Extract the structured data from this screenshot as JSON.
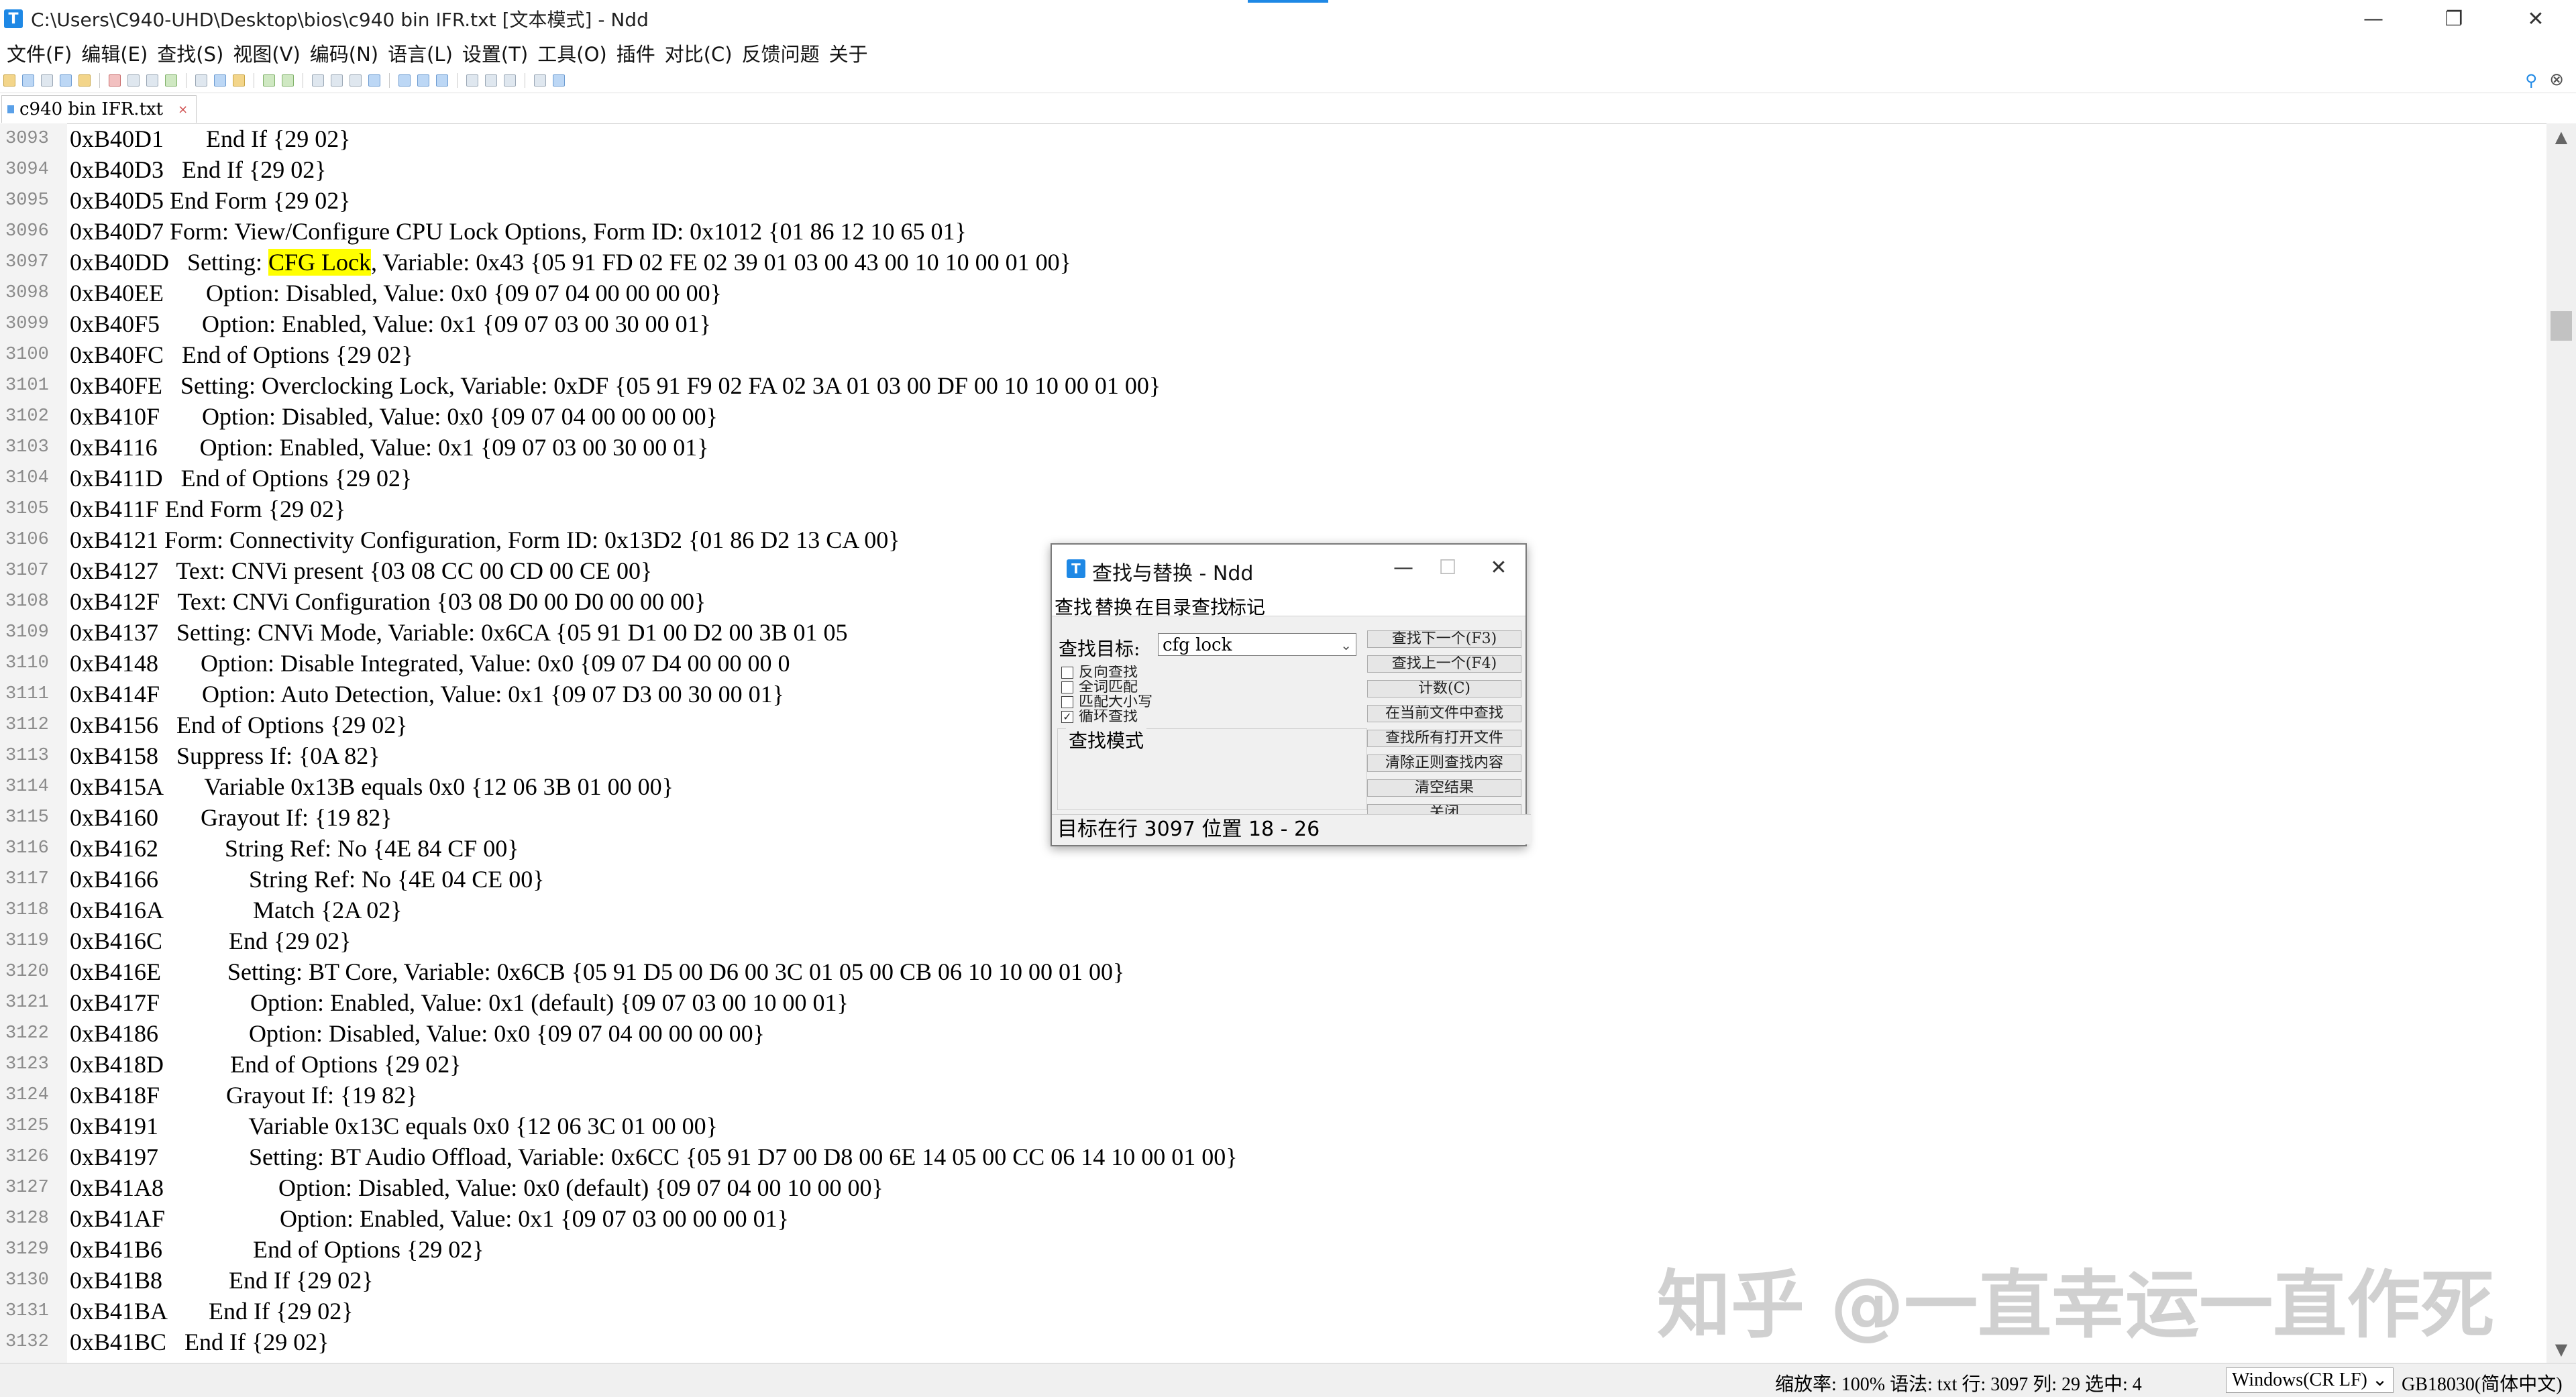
{
  "window": {
    "title": "C:\\Users\\C940-UHD\\Desktop\\bios\\c940 bin IFR.txt [文本模式] - Ndd",
    "app_icon_letter": "T",
    "minimize": "—",
    "restore": "❐",
    "close": "✕"
  },
  "menu": [
    "文件(F)",
    "编辑(E)",
    "查找(S)",
    "视图(V)",
    "编码(N)",
    "语言(L)",
    "设置(T)",
    "工具(O)",
    "插件",
    "对比(C)",
    "反馈问题",
    "关于"
  ],
  "tab": {
    "label": "c940 bin IFR.txt",
    "close": "×"
  },
  "editor": {
    "highlight": "CFG Lock",
    "lines": [
      {
        "n": "3093",
        "t": "0xB40D1       End If {29 02}"
      },
      {
        "n": "3094",
        "t": "0xB40D3   End If {29 02}"
      },
      {
        "n": "3095",
        "t": "0xB40D5 End Form {29 02}"
      },
      {
        "n": "3096",
        "t": "0xB40D7 Form: View/Configure CPU Lock Options, Form ID: 0x1012 {01 86 12 10 65 01}"
      },
      {
        "n": "3097",
        "t": "0xB40DD   Setting: CFG Lock, Variable: 0x43 {05 91 FD 02 FE 02 39 01 03 00 43 00 10 10 00 01 00}"
      },
      {
        "n": "3098",
        "t": "0xB40EE       Option: Disabled, Value: 0x0 {09 07 04 00 00 00 00}"
      },
      {
        "n": "3099",
        "t": "0xB40F5       Option: Enabled, Value: 0x1 {09 07 03 00 30 00 01}"
      },
      {
        "n": "3100",
        "t": "0xB40FC   End of Options {29 02}"
      },
      {
        "n": "3101",
        "t": "0xB40FE   Setting: Overclocking Lock, Variable: 0xDF {05 91 F9 02 FA 02 3A 01 03 00 DF 00 10 10 00 01 00}"
      },
      {
        "n": "3102",
        "t": "0xB410F       Option: Disabled, Value: 0x0 {09 07 04 00 00 00 00}"
      },
      {
        "n": "3103",
        "t": "0xB4116       Option: Enabled, Value: 0x1 {09 07 03 00 30 00 01}"
      },
      {
        "n": "3104",
        "t": "0xB411D   End of Options {29 02}"
      },
      {
        "n": "3105",
        "t": "0xB411F End Form {29 02}"
      },
      {
        "n": "3106",
        "t": "0xB4121 Form: Connectivity Configuration, Form ID: 0x13D2 {01 86 D2 13 CA 00}"
      },
      {
        "n": "3107",
        "t": "0xB4127   Text: CNVi present {03 08 CC 00 CD 00 CE 00}"
      },
      {
        "n": "3108",
        "t": "0xB412F   Text: CNVi Configuration {03 08 D0 00 D0 00 00 00}"
      },
      {
        "n": "3109",
        "t": "0xB4137   Setting: CNVi Mode, Variable: 0x6CA {05 91 D1 00 D2 00 3B 01 05"
      },
      {
        "n": "3110",
        "t": "0xB4148       Option: Disable Integrated, Value: 0x0 {09 07 D4 00 00 00 0"
      },
      {
        "n": "3111",
        "t": "0xB414F       Option: Auto Detection, Value: 0x1 {09 07 D3 00 30 00 01}"
      },
      {
        "n": "3112",
        "t": "0xB4156   End of Options {29 02}"
      },
      {
        "n": "3113",
        "t": "0xB4158   Suppress If: {0A 82}"
      },
      {
        "n": "3114",
        "t": "0xB415A       Variable 0x13B equals 0x0 {12 06 3B 01 00 00}"
      },
      {
        "n": "3115",
        "t": "0xB4160       Grayout If: {19 82}"
      },
      {
        "n": "3116",
        "t": "0xB4162           String Ref: No {4E 84 CF 00}"
      },
      {
        "n": "3117",
        "t": "0xB4166               String Ref: No {4E 04 CE 00}"
      },
      {
        "n": "3118",
        "t": "0xB416A               Match {2A 02}"
      },
      {
        "n": "3119",
        "t": "0xB416C           End {29 02}"
      },
      {
        "n": "3120",
        "t": "0xB416E           Setting: BT Core, Variable: 0x6CB {05 91 D5 00 D6 00 3C 01 05 00 CB 06 10 10 00 01 00}"
      },
      {
        "n": "3121",
        "t": "0xB417F               Option: Enabled, Value: 0x1 (default) {09 07 03 00 10 00 01}"
      },
      {
        "n": "3122",
        "t": "0xB4186               Option: Disabled, Value: 0x0 {09 07 04 00 00 00 00}"
      },
      {
        "n": "3123",
        "t": "0xB418D           End of Options {29 02}"
      },
      {
        "n": "3124",
        "t": "0xB418F           Grayout If: {19 82}"
      },
      {
        "n": "3125",
        "t": "0xB4191               Variable 0x13C equals 0x0 {12 06 3C 01 00 00}"
      },
      {
        "n": "3126",
        "t": "0xB4197               Setting: BT Audio Offload, Variable: 0x6CC {05 91 D7 00 D8 00 6E 14 05 00 CC 06 14 10 00 01 00}"
      },
      {
        "n": "3127",
        "t": "0xB41A8                   Option: Disabled, Value: 0x0 (default) {09 07 04 00 10 00 00}"
      },
      {
        "n": "3128",
        "t": "0xB41AF                   Option: Enabled, Value: 0x1 {09 07 03 00 00 00 01}"
      },
      {
        "n": "3129",
        "t": "0xB41B6               End of Options {29 02}"
      },
      {
        "n": "3130",
        "t": "0xB41B8           End If {29 02}"
      },
      {
        "n": "3131",
        "t": "0xB41BA       End If {29 02}"
      },
      {
        "n": "3132",
        "t": "0xB41BC   End If {29 02}"
      }
    ]
  },
  "find_dialog": {
    "title": "查找与替换 - Ndd",
    "tabs": [
      "查找",
      "替换",
      "在目录查找",
      "标记"
    ],
    "target_label": "查找目标:",
    "target_value": "cfg lock",
    "options": [
      "反向查找",
      "全词匹配",
      "匹配大小写",
      "循环查找"
    ],
    "options_checked": [
      false,
      false,
      false,
      true
    ],
    "mode_group": "查找模式",
    "buttons": [
      "查找下一个(F3)",
      "查找上一个(F4)",
      "计数(C)",
      "在当前文件中查找",
      "查找所有打开文件",
      "清除正则查找内容",
      "清空结果",
      "关闭"
    ],
    "status": "目标在行 3097 位置 18 - 26"
  },
  "status": {
    "info": "缩放率: 100% 语法: txt 行: 3097 列: 29 选中: 4",
    "eol": "Windows(CR LF)",
    "encoding": "GB18030(简体中文)"
  },
  "watermark": "知乎 @一直幸运一直作死",
  "colors": {
    "accent": "#1e88e5",
    "highlight": "#ffff00",
    "gutter": "#f3f3f3"
  }
}
